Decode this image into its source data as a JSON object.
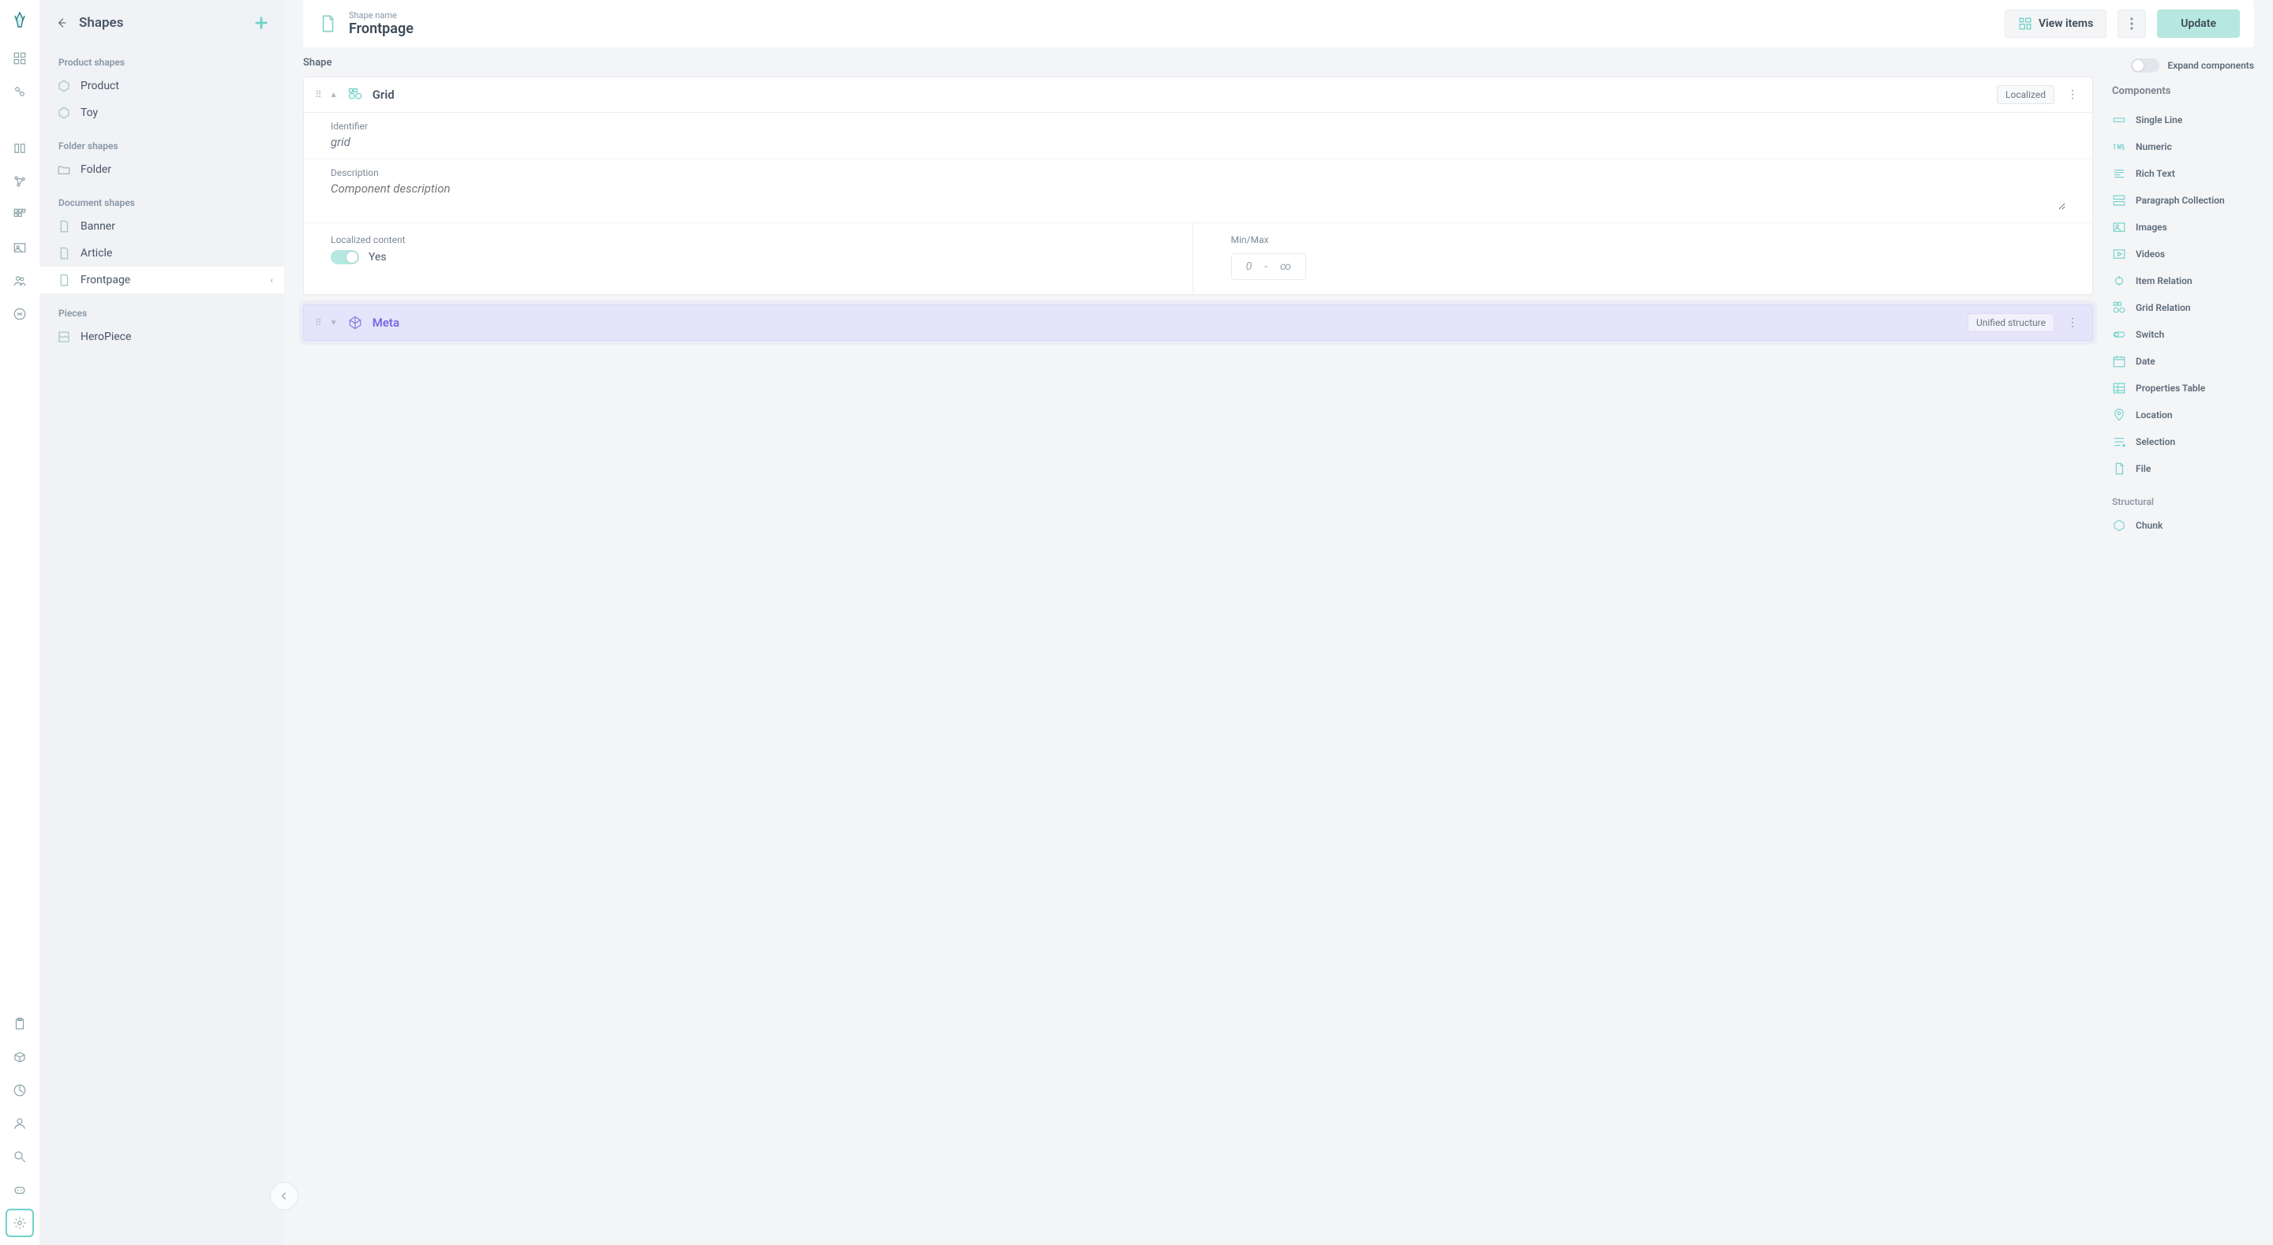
{
  "sidebar": {
    "title": "Shapes",
    "sections": {
      "product": {
        "label": "Product shapes",
        "items": [
          "Product",
          "Toy"
        ]
      },
      "folder": {
        "label": "Folder shapes",
        "items": [
          "Folder"
        ]
      },
      "document": {
        "label": "Document shapes",
        "items": [
          "Banner",
          "Article",
          "Frontpage"
        ]
      },
      "pieces": {
        "label": "Pieces",
        "items": [
          "HeroPiece"
        ]
      }
    }
  },
  "header": {
    "eyebrow": "Shape name",
    "name": "Frontpage",
    "view_items": "View items",
    "update": "Update"
  },
  "center": {
    "shape_label": "Shape",
    "expand_label": "Expand components",
    "grid": {
      "title": "Grid",
      "badge": "Localized",
      "ident_label": "Identifier",
      "ident_value": "grid",
      "desc_label": "Description",
      "desc_placeholder": "Component description",
      "loc_label": "Localized content",
      "loc_yes": "Yes",
      "minmax_label": "Min/Max",
      "min_ph": "0",
      "dash": "-",
      "max_ph": "∞"
    },
    "meta": {
      "title": "Meta",
      "badge": "Unified structure"
    }
  },
  "right": {
    "components": "Components",
    "items": [
      "Single Line",
      "Numeric",
      "Rich Text",
      "Paragraph Collection",
      "Images",
      "Videos",
      "Item Relation",
      "Grid Relation",
      "Switch",
      "Date",
      "Properties Table",
      "Location",
      "Selection",
      "File"
    ],
    "structural": "Structural",
    "struct_items": [
      "Chunk"
    ]
  }
}
